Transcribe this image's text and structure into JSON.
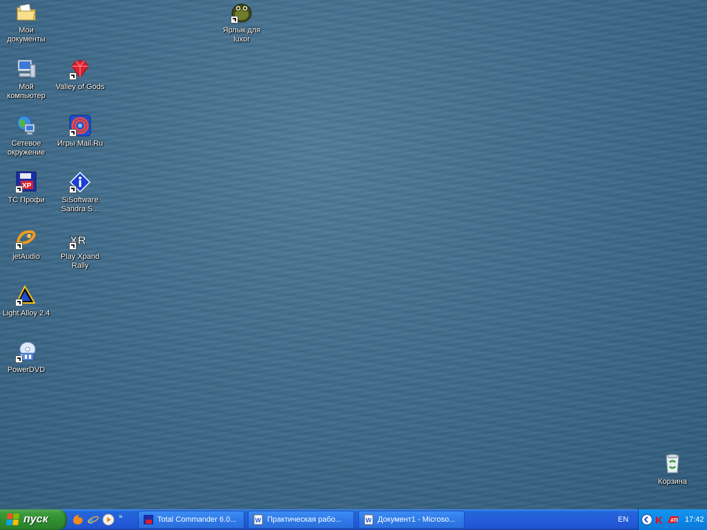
{
  "desktop": {
    "icons": [
      {
        "id": "my-documents",
        "label": "Мои\nдокументы",
        "icon": "folder-documents-icon",
        "shortcut": false
      },
      {
        "id": "my-computer",
        "label": "Мой\nкомпьютер",
        "icon": "computer-icon",
        "shortcut": false
      },
      {
        "id": "network",
        "label": "Сетевое\nокружение",
        "icon": "network-icon",
        "shortcut": false
      },
      {
        "id": "tc-profi",
        "label": "TC Профи",
        "icon": "total-commander-icon",
        "shortcut": true
      },
      {
        "id": "jetaudio",
        "label": "jetAudio",
        "icon": "jetaudio-icon",
        "shortcut": true
      },
      {
        "id": "light-alloy",
        "label": "Light Alloy 2.4",
        "icon": "light-alloy-icon",
        "shortcut": true
      },
      {
        "id": "powerdvd",
        "label": "PowerDVD",
        "icon": "powerdvd-icon",
        "shortcut": true
      },
      {
        "id": "valley-of-gods",
        "label": "Valley of Gods",
        "icon": "ruby-gem-icon",
        "shortcut": true
      },
      {
        "id": "mailru-games",
        "label": "Игры Mail.Ru",
        "icon": "mailru-games-icon",
        "shortcut": true
      },
      {
        "id": "sisoftware",
        "label": "SiSoftware\nSandra S...",
        "icon": "sisoftware-icon",
        "shortcut": true
      },
      {
        "id": "xpand-rally",
        "label": "Play Xpand\nRally",
        "icon": "xpand-rally-icon",
        "shortcut": true
      },
      {
        "id": "luxor",
        "label": "Ярлык для\nluxor",
        "icon": "luxor-frog-icon",
        "shortcut": true
      },
      {
        "id": "recycle-bin",
        "label": "Корзина",
        "icon": "recycle-bin-icon",
        "shortcut": false
      }
    ]
  },
  "taskbar": {
    "start_label": "пуск",
    "quicklaunch": [
      "firefox-icon",
      "internet-explorer-icon",
      "media-player-icon"
    ],
    "quicklaunch_more": "»",
    "tasks": [
      {
        "label": "Total Commander 6.0...",
        "icon": "total-commander-icon"
      },
      {
        "label": "Практическая рабо...",
        "icon": "word-document-icon"
      },
      {
        "label": "Документ1 - Microso...",
        "icon": "word-document-icon"
      }
    ],
    "language": "EN",
    "clock": "17:42",
    "tray_icons": [
      "show-hidden-icons-icon",
      "kaspersky-icon",
      "ati-icon"
    ]
  },
  "colors": {
    "start_green": "#3c9a3c",
    "taskbar_blue": "#245ddb",
    "tray_blue": "#0f86e4"
  }
}
